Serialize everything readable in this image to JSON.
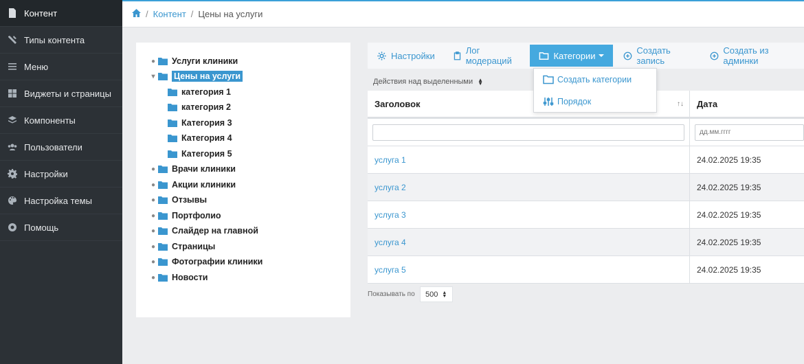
{
  "sidebar": {
    "items": [
      {
        "label": "Контент",
        "icon": "file-icon"
      },
      {
        "label": "Типы контента",
        "icon": "tools-icon"
      },
      {
        "label": "Меню",
        "icon": "list-icon"
      },
      {
        "label": "Виджеты и страницы",
        "icon": "grid-icon"
      },
      {
        "label": "Компоненты",
        "icon": "layers-icon"
      },
      {
        "label": "Пользователи",
        "icon": "users-icon"
      },
      {
        "label": "Настройки",
        "icon": "gear-icon"
      },
      {
        "label": "Настройка темы",
        "icon": "palette-icon"
      },
      {
        "label": "Помощь",
        "icon": "lifebuoy-icon"
      }
    ]
  },
  "breadcrumb": {
    "link": "Контент",
    "separator": "/",
    "current": "Цены на услуги"
  },
  "tree": {
    "items": [
      {
        "label": "Услуги клиники",
        "level": 0
      },
      {
        "label": "Цены на услуги",
        "level": 0,
        "selected": true,
        "expanded": true
      },
      {
        "label": "категория 1",
        "level": 1
      },
      {
        "label": "категория 2",
        "level": 1
      },
      {
        "label": "Категория 3",
        "level": 1
      },
      {
        "label": "Категория 4",
        "level": 1
      },
      {
        "label": "Категория 5",
        "level": 1
      },
      {
        "label": "Врачи клиники",
        "level": 0
      },
      {
        "label": "Акции клиники",
        "level": 0
      },
      {
        "label": "Отзывы",
        "level": 0
      },
      {
        "label": "Портфолио",
        "level": 0
      },
      {
        "label": "Слайдер на главной",
        "level": 0
      },
      {
        "label": "Страницы",
        "level": 0
      },
      {
        "label": "Фотографии клиники",
        "level": 0
      },
      {
        "label": "Новости",
        "level": 0
      }
    ]
  },
  "toolbar": {
    "settings": "Настройки",
    "log": "Лог модераций",
    "categories": "Категории",
    "create_record": "Создать запись",
    "create_from_admin": "Создать из админки"
  },
  "dropdown": {
    "create_category": "Создать категории",
    "order": "Порядок"
  },
  "bulk_actions": "Действия над выделенными",
  "table": {
    "columns": [
      "Заголовок",
      "Дата"
    ],
    "sort_indicator": "↑↓",
    "date_placeholder": "дд.мм.гггг",
    "rows": [
      {
        "title": "услуга 1",
        "date": "24.02.2025 19:35"
      },
      {
        "title": "услуга 2",
        "date": "24.02.2025 19:35"
      },
      {
        "title": "услуга 3",
        "date": "24.02.2025 19:35"
      },
      {
        "title": "услуга 4",
        "date": "24.02.2025 19:35"
      },
      {
        "title": "услуга 5",
        "date": "24.02.2025 19:35"
      }
    ]
  },
  "pager": {
    "label": "Показывать по",
    "value": "500"
  },
  "colors": {
    "accent": "#3a96cf",
    "sidebar_bg": "#2c3136",
    "primary_button": "#45a9df"
  }
}
